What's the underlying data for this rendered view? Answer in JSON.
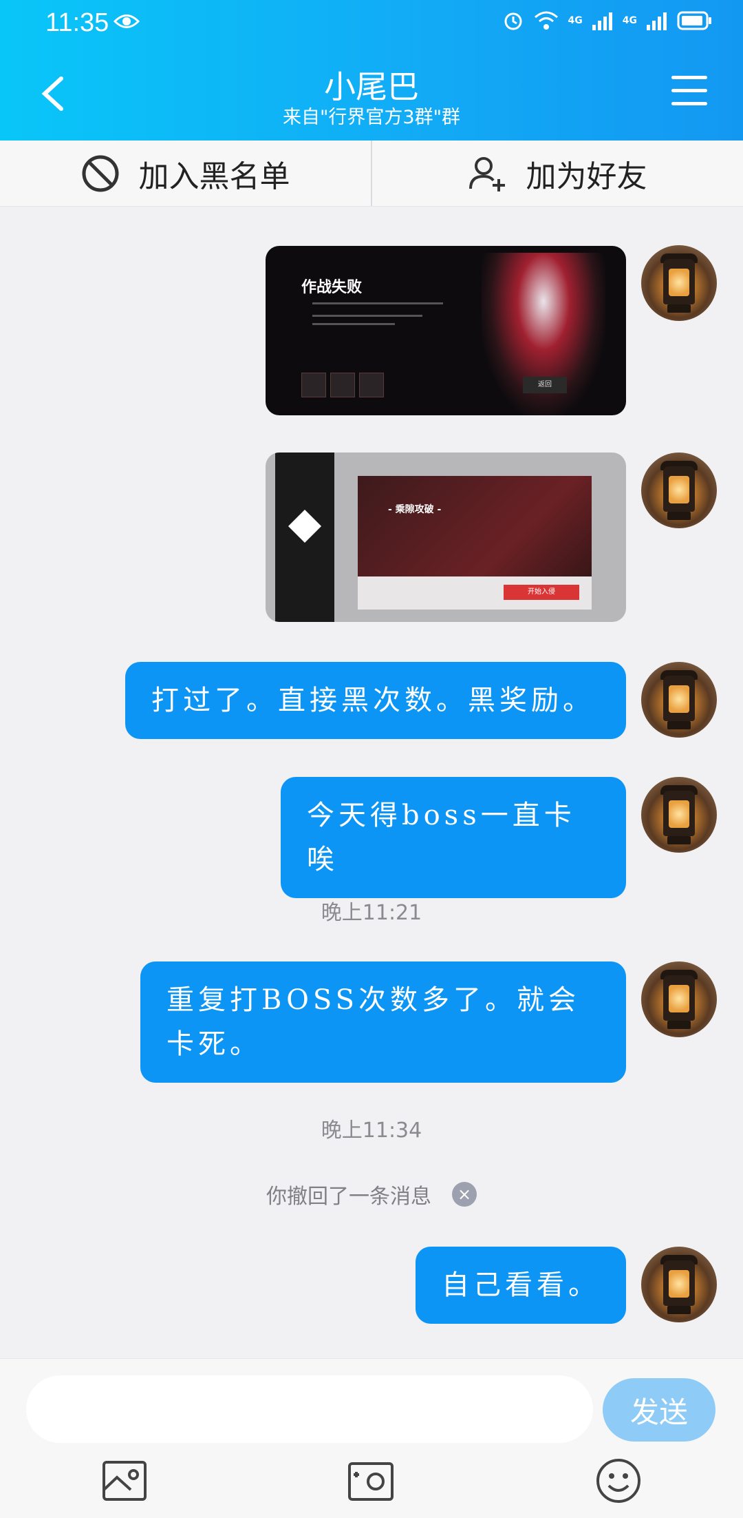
{
  "status_bar": {
    "time": "11:35",
    "network": "4G"
  },
  "header": {
    "title": "小尾巴",
    "subtitle": "来自\"行界官方3群\"群"
  },
  "actions": {
    "blacklist": "加入黑名单",
    "add_friend": "加为好友"
  },
  "messages": {
    "image1_title": "作战失败",
    "image1_button": "返回",
    "image2_title": "- 乘隙攻破 -",
    "image2_button": "开始入侵",
    "text1": "打过了。直接黑次数。黑奖励。",
    "text2": "今天得boss一直卡唉",
    "time1": "晚上11:21",
    "text3": "重复打BOSS次数多了。就会卡死。",
    "time2": "晚上11:34",
    "recall": "你撤回了一条消息",
    "text4": "自己看看。"
  },
  "input": {
    "placeholder": "",
    "send_label": "发送"
  },
  "toolbar_icons": [
    "image-icon",
    "camera-icon",
    "emoji-icon"
  ],
  "colors": {
    "header": "#12a9f5",
    "bubble": "#0d95f5",
    "send": "#8ecbf7"
  }
}
